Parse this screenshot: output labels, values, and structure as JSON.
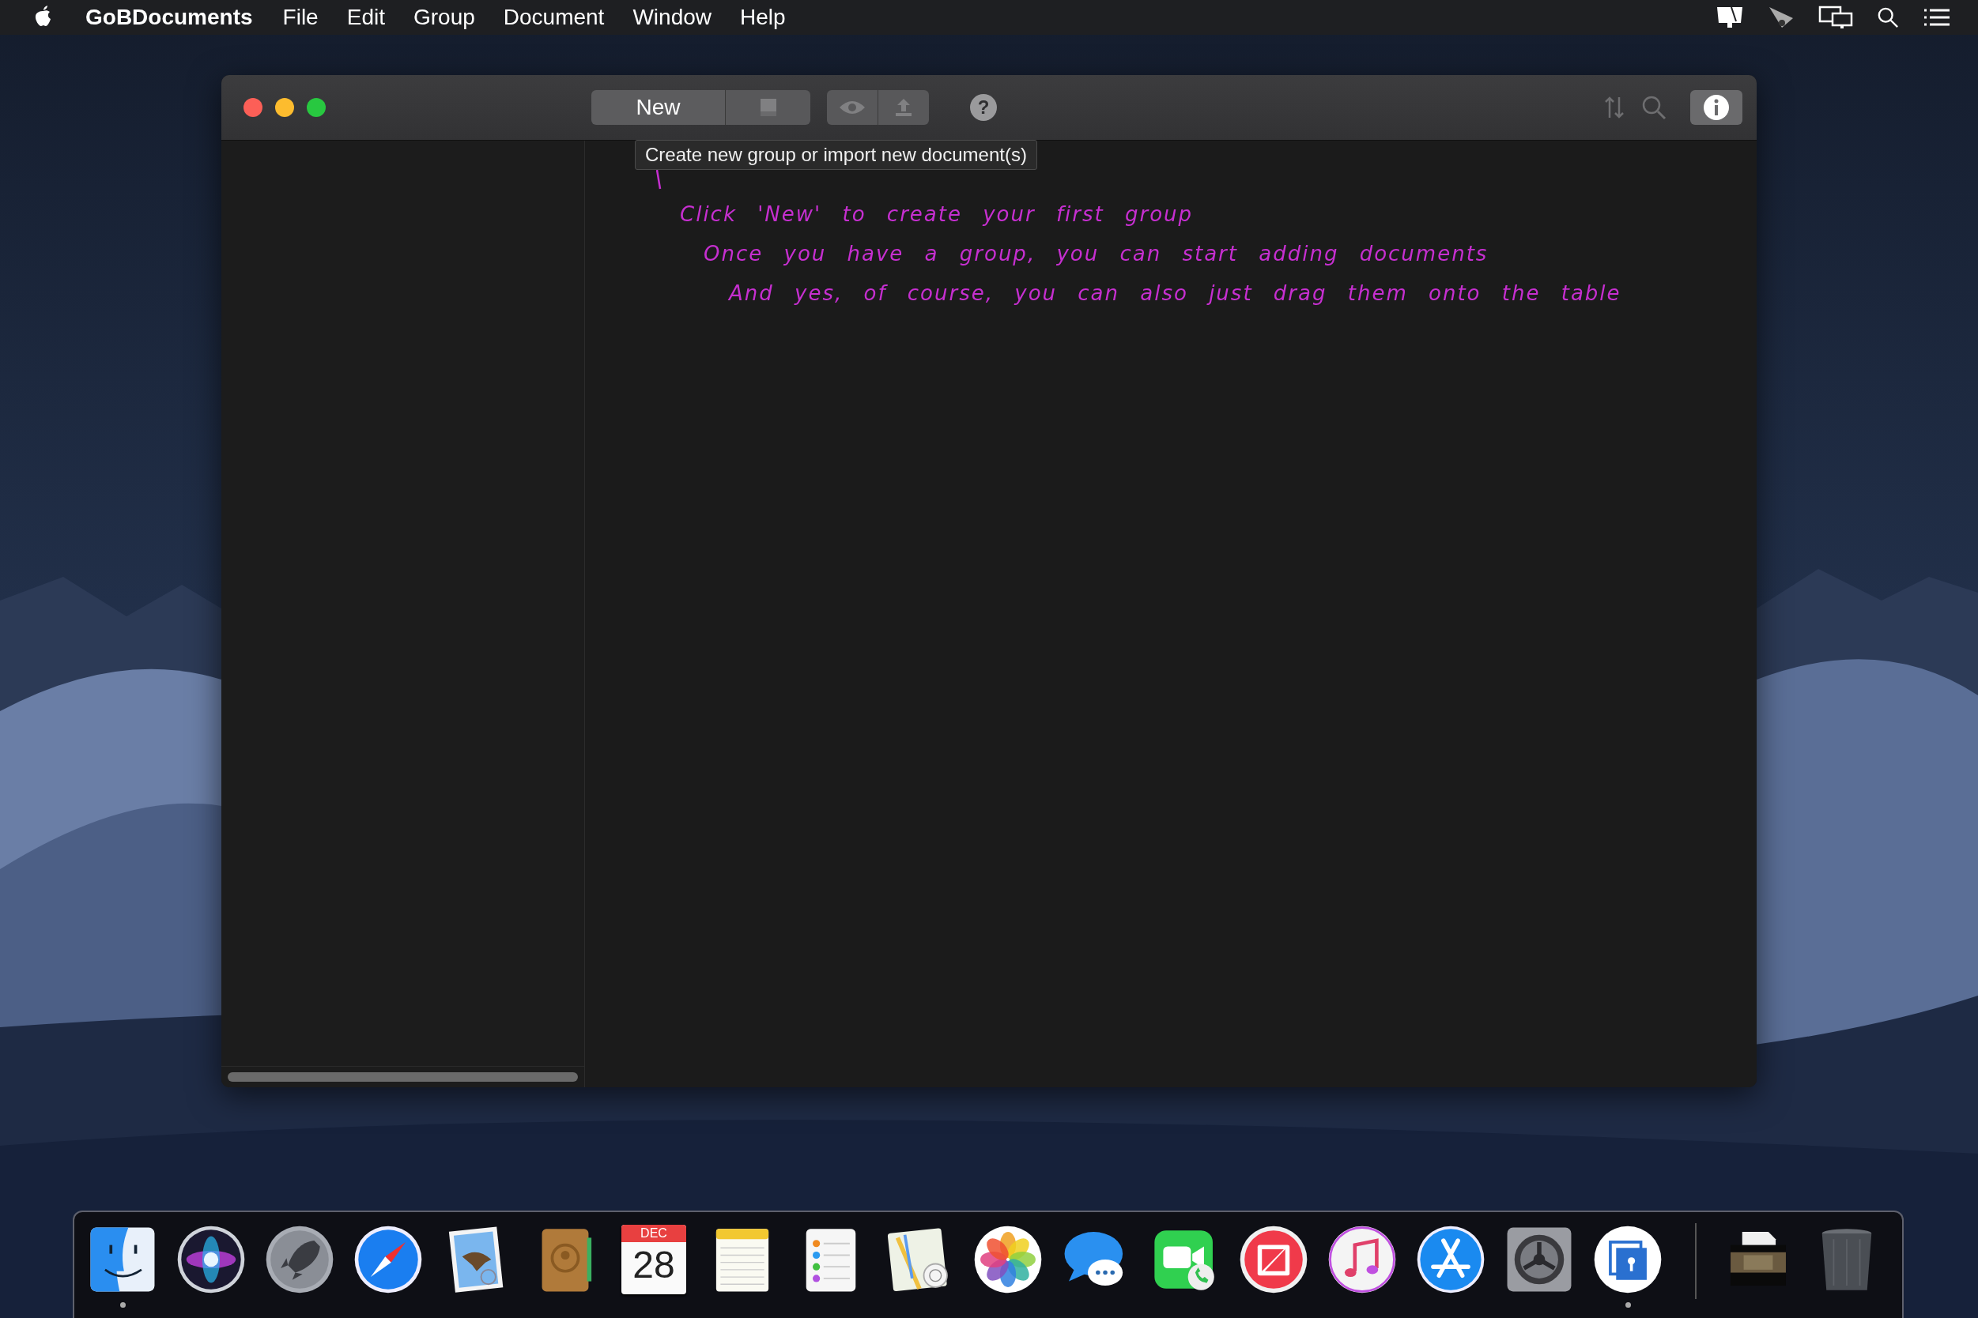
{
  "menu_bar": {
    "app_name": "GoBDocuments",
    "menus": [
      "File",
      "Edit",
      "Group",
      "Document",
      "Window",
      "Help"
    ]
  },
  "window": {
    "toolbar": {
      "new_button": "New",
      "help_button": "?"
    },
    "tooltip": "Create new group or import new document(s)",
    "hint_lines": [
      "Click 'New' to create your first group",
      "Once you have a group, you can start adding documents",
      "And yes, of course, you can also just drag them onto the table"
    ]
  },
  "dock": {
    "items": [
      {
        "kind": "finder",
        "running": true
      },
      {
        "kind": "siri",
        "running": false
      },
      {
        "kind": "launchpad",
        "running": false
      },
      {
        "kind": "safari",
        "running": false
      },
      {
        "kind": "mail",
        "running": false
      },
      {
        "kind": "contacts",
        "running": false
      },
      {
        "kind": "calendar",
        "running": false,
        "month": "DEC",
        "day": "28"
      },
      {
        "kind": "notes",
        "running": false
      },
      {
        "kind": "reminders",
        "running": false
      },
      {
        "kind": "maps",
        "running": false
      },
      {
        "kind": "photos",
        "running": false
      },
      {
        "kind": "messages",
        "running": false
      },
      {
        "kind": "facetime",
        "running": false
      },
      {
        "kind": "news",
        "running": false
      },
      {
        "kind": "music",
        "running": false
      },
      {
        "kind": "appstore",
        "running": false
      },
      {
        "kind": "preferences",
        "running": false
      },
      {
        "kind": "gobdocuments",
        "running": true
      },
      {
        "kind": "separator"
      },
      {
        "kind": "stack",
        "running": false
      },
      {
        "kind": "trash",
        "running": false
      }
    ]
  }
}
